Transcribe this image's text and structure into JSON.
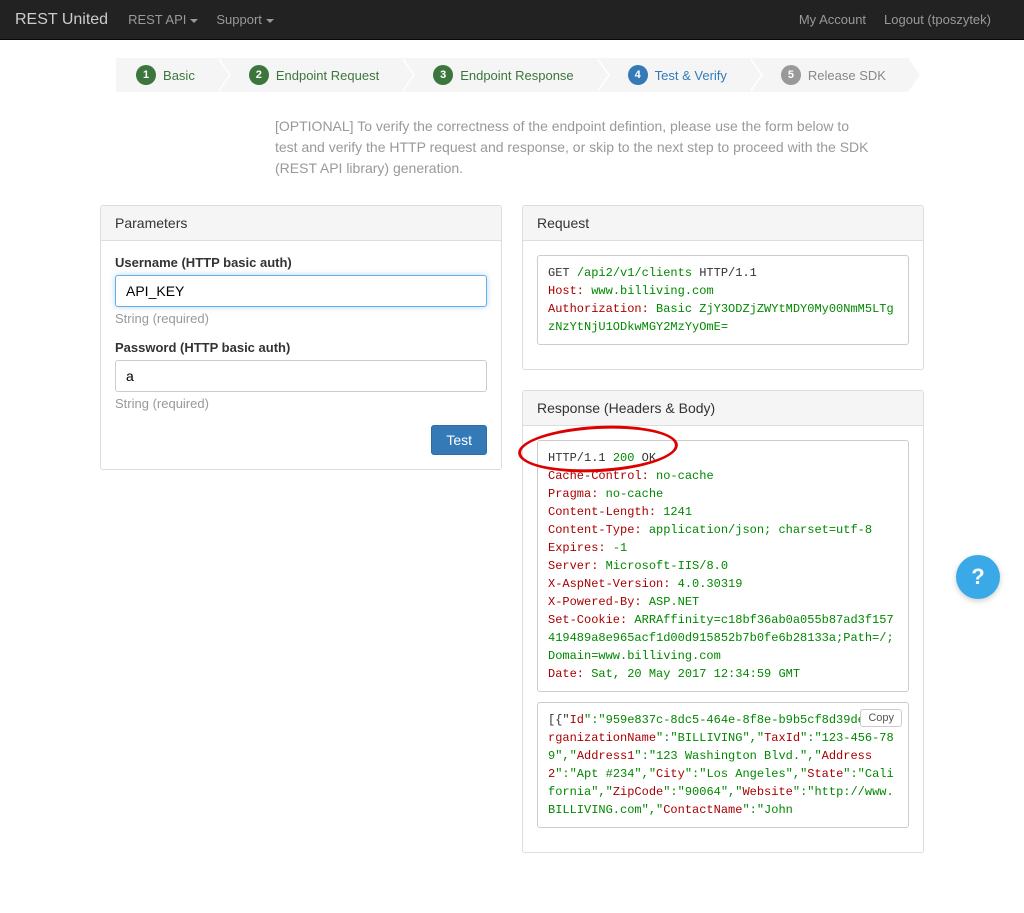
{
  "navbar": {
    "brand": "REST United",
    "items": [
      "REST API",
      "Support"
    ],
    "right": {
      "account": "My Account",
      "logout": "Logout (tposzytek)"
    }
  },
  "wizard": [
    {
      "num": "1",
      "label": "Basic",
      "state": "done"
    },
    {
      "num": "2",
      "label": "Endpoint Request",
      "state": "done"
    },
    {
      "num": "3",
      "label": "Endpoint Response",
      "state": "done"
    },
    {
      "num": "4",
      "label": "Test & Verify",
      "state": "active"
    },
    {
      "num": "5",
      "label": "Release SDK",
      "state": "todo"
    }
  ],
  "intro": "[OPTIONAL] To verify the correctness of the endpoint defintion, please use the form below to test and verify the HTTP request and response, or skip to the next step to proceed with the SDK (REST API library) generation.",
  "parameters": {
    "heading": "Parameters",
    "username": {
      "label": "Username (HTTP basic auth)",
      "value": "API_KEY",
      "help": "String (required)"
    },
    "password": {
      "label": "Password (HTTP basic auth)",
      "value": "a",
      "help": "String (required)"
    },
    "test_btn": "Test"
  },
  "request": {
    "heading": "Request",
    "method": "GET",
    "path": "/api2/v1/clients",
    "http": "HTTP/1.1",
    "host_key": "Host:",
    "host_val": "www.billiving.com",
    "auth_key": "Authorization:",
    "auth_val": "Basic ZjY3ODZjZWYtMDY0My00NmM5LTgzNzYtNjU1ODkwMGY2MzYyOmE="
  },
  "response": {
    "heading": "Response (Headers & Body)",
    "status_line": {
      "proto": "HTTP/1.1",
      "code": "200",
      "reason": "OK"
    },
    "headers": [
      {
        "k": "Cache-Control:",
        "v": "no-cache"
      },
      {
        "k": "Pragma:",
        "v": "no-cache"
      },
      {
        "k": "Content-Length:",
        "v": "1241"
      },
      {
        "k": "Content-Type:",
        "v": "application/json; charset=utf-8"
      },
      {
        "k": "Expires:",
        "v": "-1"
      },
      {
        "k": "Server:",
        "v": "Microsoft-IIS/8.0"
      },
      {
        "k": "X-AspNet-Version:",
        "v": "4.0.30319"
      },
      {
        "k": "X-Powered-By:",
        "v": "ASP.NET"
      },
      {
        "k": "Set-Cookie:",
        "v": "ARRAffinity=c18bf36ab0a055b87ad3f157419489a8e965acf1d00d915852b7b0fe6b28133a;Path=/;Domain=www.billiving.com"
      },
      {
        "k": "Date:",
        "v": "Sat, 20 May 2017 12:34:59 GMT"
      }
    ],
    "body_json_parts": {
      "p1": "[{\"",
      "id_k": "Id",
      "id_v": "\":\"959e837c-8dc5-464e-8f8e-b9b5cf8d39de\",\"",
      "org_k": "OrganizationName",
      "org_v": "\":\"BILLIVING\",\"",
      "tax_k": "TaxId",
      "tax_v": "\":\"123-456-789\",\"",
      "a1_k": "Address1",
      "a1_v": "\":\"123 Washington Blvd.\",\"",
      "a2_k": "Address2",
      "a2_v": "\":\"Apt #234\",\"",
      "city_k": "City",
      "city_v": "\":\"Los Angeles\",\"",
      "st_k": "State",
      "st_v": "\":\"California\",\"",
      "zip_k": "ZipCode",
      "zip_v": "\":\"90064\",\"",
      "web_k": "Website",
      "web_v": "\":\"http://www.BILLIVING.com\",\"",
      "cn_k": "ContactName",
      "cn_v": "\":\"John"
    },
    "copy": "Copy"
  },
  "help_fab": "?"
}
